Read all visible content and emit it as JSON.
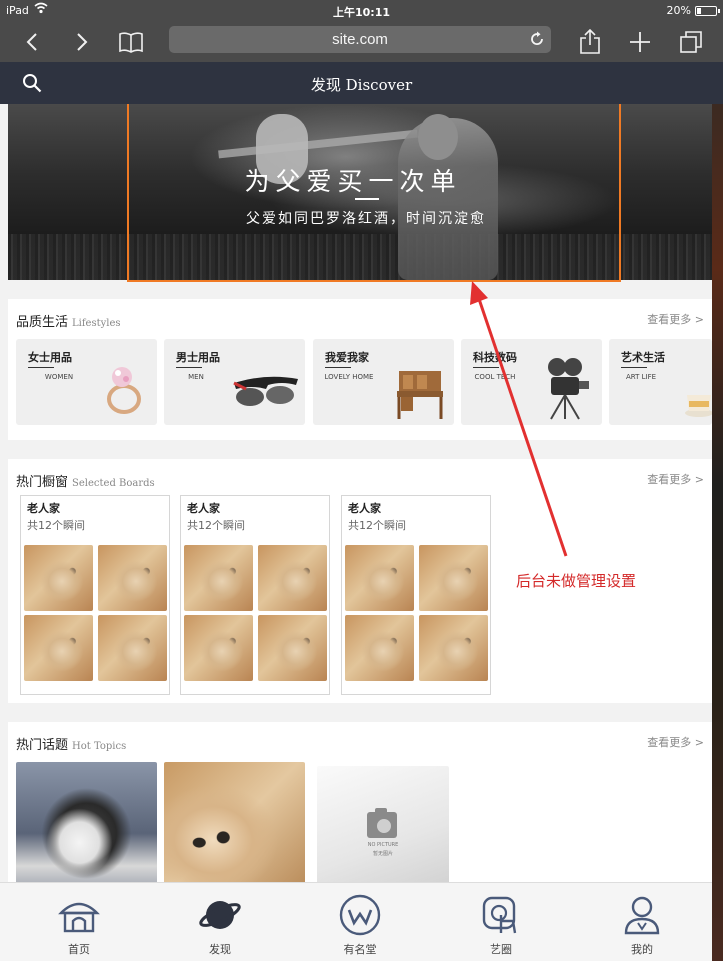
{
  "status_bar": {
    "carrier": "iPad",
    "time": "上午10:11",
    "battery": "20%",
    "battery_level": 0.2
  },
  "browser": {
    "url": "site.com",
    "icons": [
      "back-icon",
      "forward-icon",
      "bookmarks-icon",
      "reload-icon",
      "share-icon",
      "add-tab-icon",
      "tabs-icon"
    ]
  },
  "app_header": {
    "title": "发现 Discover",
    "search_icon": "search-icon"
  },
  "banner": {
    "headline": "为父爱买一次单",
    "subline": "父爱如同巴罗洛红酒，时间沉淀愈"
  },
  "lifestyles": {
    "title_cn": "品质生活",
    "title_en": "Lifestyles",
    "more": "查看更多 >",
    "items": [
      {
        "cn": "女士用品",
        "en": "WOMEN",
        "icon": "ring-icon"
      },
      {
        "cn": "男士用品",
        "en": "MEN",
        "icon": "sunglasses-icon"
      },
      {
        "cn": "我爱我家",
        "en": "LOVELY HOME",
        "icon": "desk-icon"
      },
      {
        "cn": "科技数码",
        "en": "COOL TECH",
        "icon": "projector-icon"
      },
      {
        "cn": "艺术生活",
        "en": "ART LIFE",
        "icon": "teacup-icon"
      }
    ]
  },
  "boards": {
    "title_cn": "热门橱窗",
    "title_en": "Selected Boards",
    "more": "查看更多 >",
    "items": [
      {
        "title": "老人家",
        "subtitle": "共12个瞬间"
      },
      {
        "title": "老人家",
        "subtitle": "共12个瞬间"
      },
      {
        "title": "老人家",
        "subtitle": "共12个瞬间"
      }
    ]
  },
  "topics": {
    "title_cn": "热门话题",
    "title_en": "Hot Topics",
    "more": "查看更多 >",
    "no_picture_en": "NO PICTURE",
    "no_picture_cn": "暂无图片"
  },
  "annotation": {
    "text": "后台未做管理设置",
    "color": "#d42a2a"
  },
  "highlight_color": "#f07a24",
  "tabbar": {
    "items": [
      {
        "label": "首页",
        "icon": "home-icon"
      },
      {
        "label": "发现",
        "icon": "planet-icon"
      },
      {
        "label": "有名堂",
        "icon": "w-circle-icon"
      },
      {
        "label": "艺圈",
        "icon": "touch-icon"
      },
      {
        "label": "我的",
        "icon": "user-icon"
      }
    ]
  }
}
